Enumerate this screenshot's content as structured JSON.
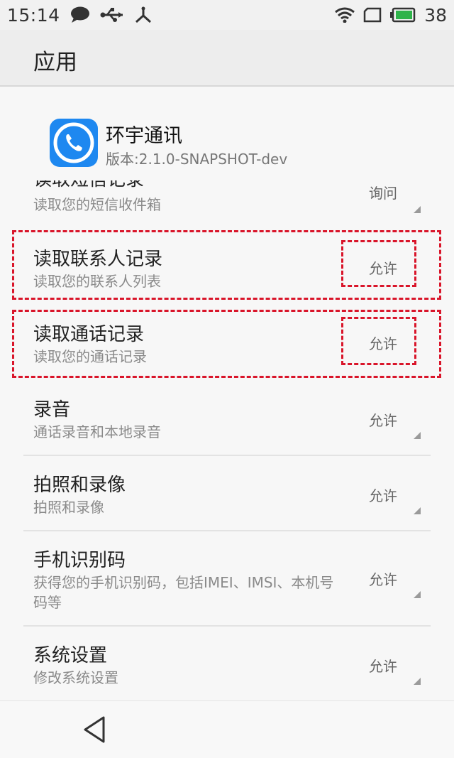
{
  "status_bar": {
    "time": "15:14",
    "battery_percent": "38",
    "icons": [
      "message-icon",
      "usb-icon",
      "debug-icon",
      "wifi-icon",
      "sim-icon",
      "battery-icon"
    ]
  },
  "app_bar": {
    "title": "应用"
  },
  "app_info": {
    "name": "环宇通讯",
    "version": "版本:2.1.0-SNAPSHOT-dev",
    "icon": "phone-app-icon",
    "icon_color": "#1e88f0"
  },
  "permissions": [
    {
      "title": "读取短信记录",
      "desc": "读取您的短信收件箱",
      "value": "询问"
    },
    {
      "title": "读取联系人记录",
      "desc": "读取您的联系人列表",
      "value": "允许"
    },
    {
      "title": "读取通话记录",
      "desc": "读取您的通话记录",
      "value": "允许"
    },
    {
      "title": "录音",
      "desc": "通话录音和本地录音",
      "value": "允许"
    },
    {
      "title": "拍照和录像",
      "desc": "拍照和录像",
      "value": "允许"
    },
    {
      "title": "手机识别码",
      "desc": "获得您的手机识别码，包括IMEI、IMSI、本机号码等",
      "value": "允许"
    },
    {
      "title": "系统设置",
      "desc": "修改系统设置",
      "value": "允许"
    }
  ],
  "highlight_color": "#d9152a",
  "nav_bar": {
    "back": "back-triangle-icon"
  }
}
